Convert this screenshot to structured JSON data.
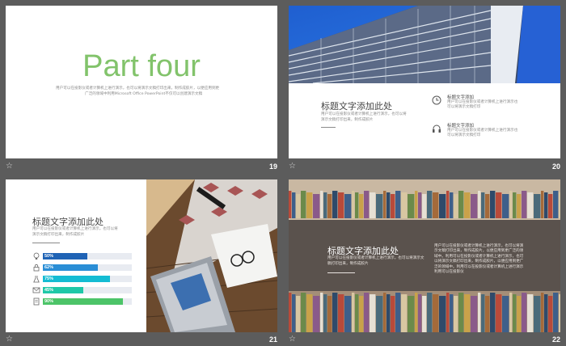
{
  "slides": [
    {
      "number": "19",
      "title": "Part four",
      "title_color": "#82c36b",
      "body_lines": [
        "用户可以在投影仪或者计算机上进行演示，也可以将演示文稿打印出来，制作成胶片，以便应用到更",
        "广泛的领域中利用Microsoft  Office PowerPoint不仅可以创建演示文稿"
      ]
    },
    {
      "number": "20",
      "heading": "标题文字添加此处",
      "body_lines": [
        "用户可以在投影仪或者计算机上进行演示，也可以将",
        "演示文稿打印出来，制作成胶片"
      ],
      "features": [
        {
          "icon": "clock-icon",
          "title": "标题文字添加",
          "lines": [
            "用户可以在投影仪或者计算机上进行演示也",
            "可以将演示文稿打印"
          ]
        },
        {
          "icon": "headphones-icon",
          "title": "标题文字添加",
          "lines": [
            "用户可以在投影仪或者计算机上进行演示也",
            "可以将演示文稿打印"
          ]
        }
      ]
    },
    {
      "number": "21",
      "heading": "标题文字添加此处",
      "body_lines": [
        "用户可以在投影仪或者计算机上进行演示，也可以将",
        "演示文稿打印出来，制作成胶片"
      ],
      "bars": [
        {
          "icon": "lightbulb-icon",
          "label": "50%",
          "value": 0.5,
          "color": "#1f63b5"
        },
        {
          "icon": "lock-icon",
          "label": "62%",
          "value": 0.62,
          "color": "#2a8ed6"
        },
        {
          "icon": "flask-icon",
          "label": "75%",
          "value": 0.75,
          "color": "#14bcd3"
        },
        {
          "icon": "envelope-icon",
          "label": "45%",
          "value": 0.45,
          "color": "#1fc8a8"
        },
        {
          "icon": "document-icon",
          "label": "90%",
          "value": 0.9,
          "color": "#4cc468"
        }
      ]
    },
    {
      "number": "22",
      "heading": "标题文字添加此处",
      "left_lines": [
        "用户可以在投影仪或者计算机上进行演示，也可以将演示文",
        "稿打印出来，制作成胶片"
      ],
      "right_lines": [
        "用户可以在投影仪或者计算机上进行演示，也可以将演",
        "示文稿打印出来，制作成胶片，以便应用到更广泛的领",
        "域中。利用可以在投影仪或者计算机上进行演示，也可",
        "以将演示文稿打印出来，制作成胶片，以便应用到更广",
        "泛的领域中。利用可以在投影仪或者计算机上进行演示",
        "利用可以在投影仪"
      ]
    }
  ]
}
